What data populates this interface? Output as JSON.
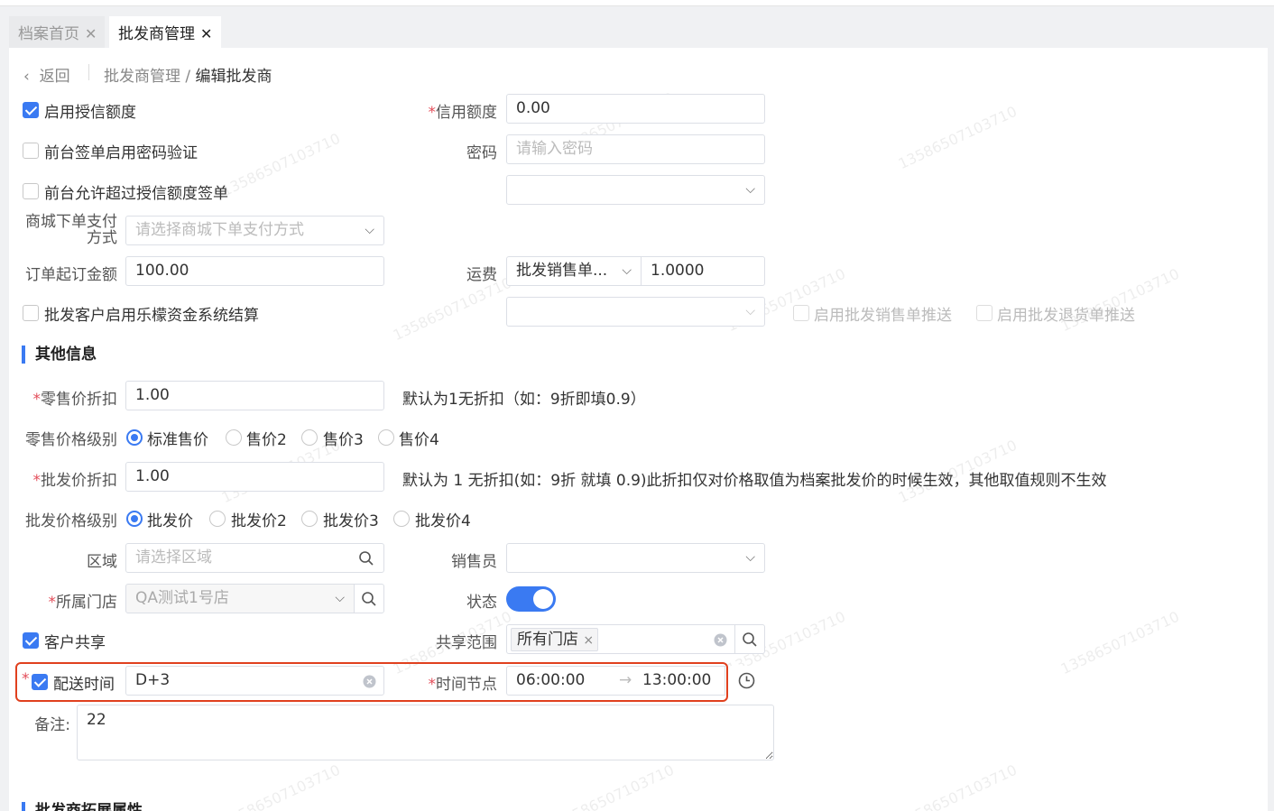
{
  "tabs": [
    {
      "label": "档案首页",
      "close": "✕"
    },
    {
      "label": "批发商管理",
      "close": "✕"
    }
  ],
  "breadcrumb": {
    "back": "返回",
    "parent": "批发商管理",
    "sep": "/",
    "current": "编辑批发商"
  },
  "watermark": "13586507103710",
  "form": {
    "enable_credit": {
      "label": "启用授信额度",
      "checked": true
    },
    "credit_limit": {
      "label": "信用额度",
      "value": "0.00"
    },
    "pwd_verify": {
      "label": "前台签单启用密码验证",
      "checked": false
    },
    "password": {
      "label": "密码",
      "placeholder": "请输入密码"
    },
    "over_credit": {
      "label": "前台允许超过授信额度签单",
      "checked": false
    },
    "mall_pay": {
      "label_line1": "商城下单支付",
      "label_line2": "方式",
      "placeholder": "请选择商城下单支付方式"
    },
    "min_order": {
      "label": "订单起订金额",
      "value": "100.00"
    },
    "freight": {
      "label": "运费",
      "select_value": "批发销售单...",
      "value": "1.0000"
    },
    "lemon_settle": {
      "label": "批发客户启用乐檬资金系统结算",
      "checked": false
    },
    "push_sales": {
      "label": "启用批发销售单推送"
    },
    "push_return": {
      "label": "启用批发退货单推送"
    }
  },
  "other": {
    "title": "其他信息",
    "retail_discount": {
      "label": "零售价折扣",
      "value": "1.00",
      "hint": "默认为1无折扣（如：9折即填0.9）"
    },
    "retail_price_level": {
      "label": "零售价格级别",
      "options": [
        "标准售价",
        "售价2",
        "售价3",
        "售价4"
      ],
      "selected": 0
    },
    "wholesale_discount": {
      "label": "批发价折扣",
      "value": "1.00",
      "hint": "默认为 1 无折扣(如：9折 就填 0.9)此折扣仅对价格取值为档案批发价的时候生效，其他取值规则不生效"
    },
    "wholesale_price_level": {
      "label": "批发价格级别",
      "options": [
        "批发价",
        "批发价2",
        "批发价3",
        "批发价4"
      ],
      "selected": 0
    },
    "region": {
      "label": "区域",
      "placeholder": "请选择区域"
    },
    "salesman": {
      "label": "销售员"
    },
    "store": {
      "label": "所属门店",
      "value": "QA测试1号店"
    },
    "status": {
      "label": "状态",
      "on": true
    },
    "share": {
      "label": "客户共享",
      "checked": true
    },
    "share_scope": {
      "label": "共享范围",
      "tag": "所有门店",
      "tag_close": "×"
    },
    "delivery": {
      "label": "配送时间",
      "checked": true,
      "value": "D+3"
    },
    "time_node": {
      "label": "时间节点",
      "start": "06:00:00",
      "arrow": "→",
      "end": "13:00:00"
    },
    "remark": {
      "label": "备注:",
      "value": "22"
    }
  },
  "next_section_title": "批发商拓展属性",
  "colors": {
    "accent": "#3a7af2",
    "required": "#e34d59",
    "highlight": "#e0401e"
  }
}
